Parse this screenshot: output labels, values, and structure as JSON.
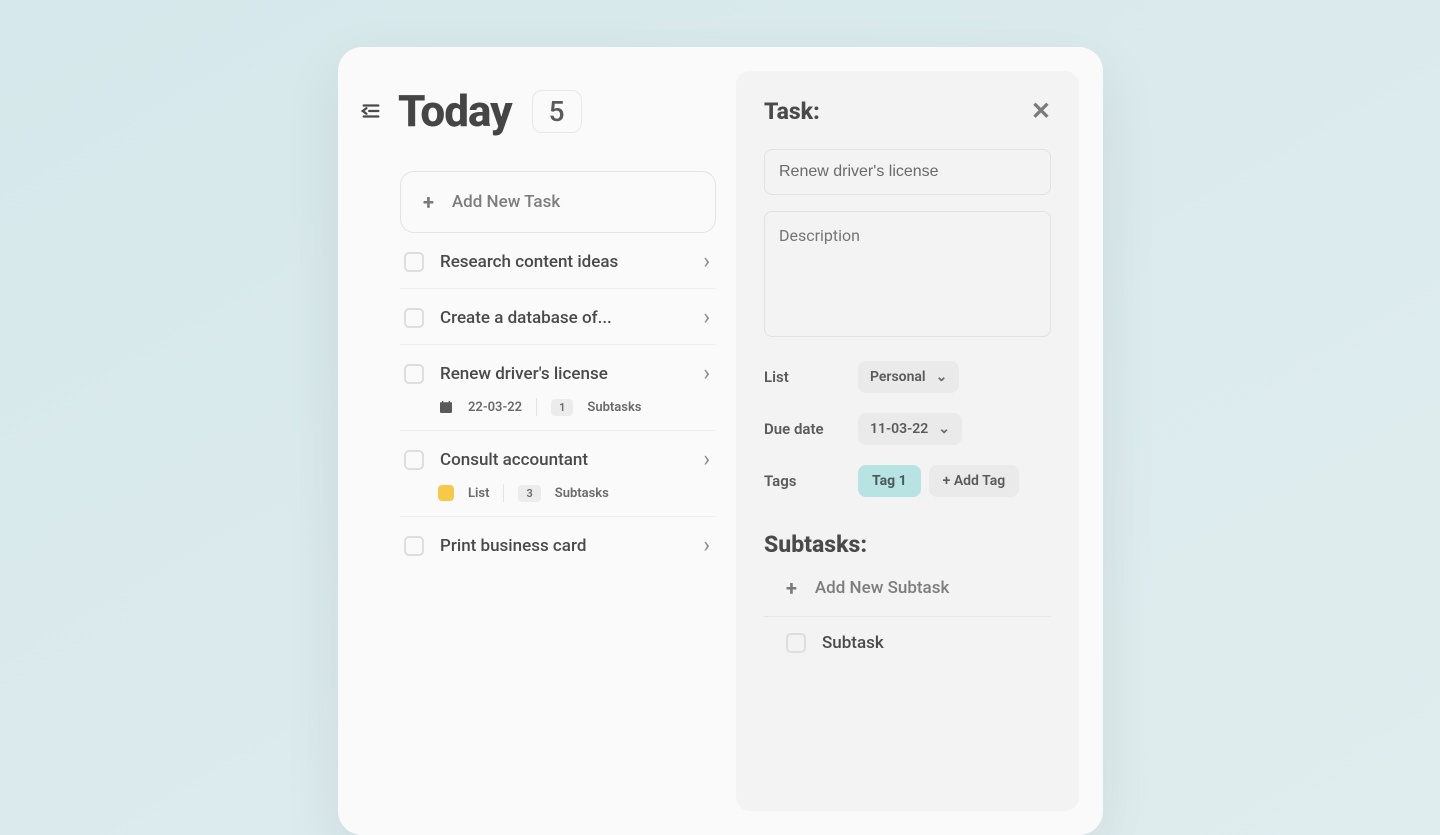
{
  "header": {
    "title": "Today",
    "count": "5"
  },
  "add_task_label": "Add New Task",
  "tasks": [
    {
      "title": "Research content ideas"
    },
    {
      "title": "Create a database of..."
    },
    {
      "title": "Renew driver's license",
      "date": "22-03-22",
      "subtask_count": "1",
      "subtasks_label": "Subtasks"
    },
    {
      "title": "Consult accountant",
      "list_label": "List",
      "subtask_count": "3",
      "subtasks_label": "Subtasks"
    },
    {
      "title": "Print business card"
    }
  ],
  "detail": {
    "heading": "Task:",
    "task_name": "Renew driver's license",
    "desc_placeholder": "Description",
    "list_label": "List",
    "list_value": "Personal",
    "due_label": "Due date",
    "due_value": "11-03-22",
    "tags_label": "Tags",
    "tag1": "Tag 1",
    "add_tag": "+ Add Tag",
    "subtasks_heading": "Subtasks:",
    "add_subtask_label": "Add New Subtask",
    "subtask1": "Subtask"
  }
}
